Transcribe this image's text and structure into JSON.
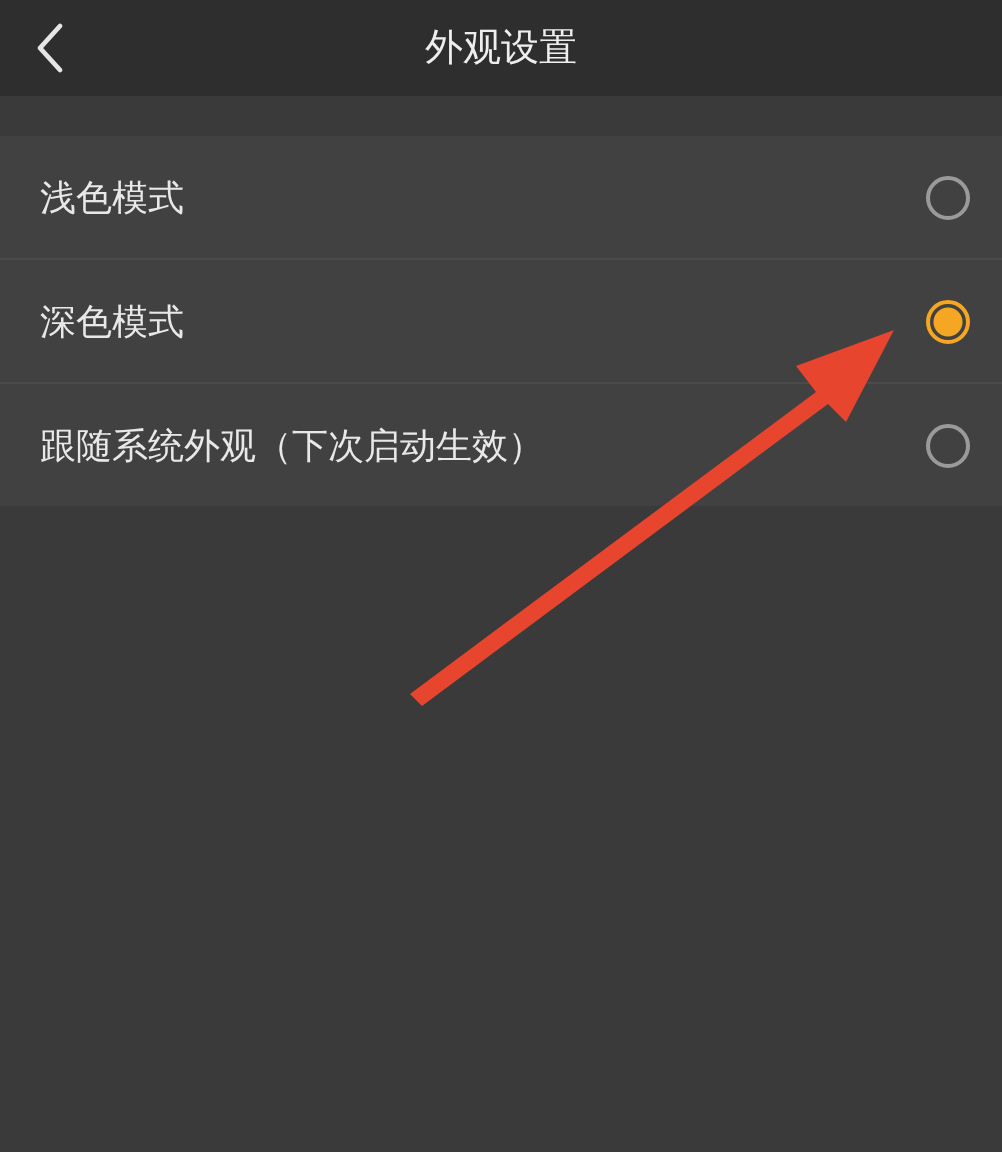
{
  "header": {
    "title": "外观设置"
  },
  "options": [
    {
      "label": "浅色模式",
      "selected": false
    },
    {
      "label": "深色模式",
      "selected": true
    },
    {
      "label": "跟随系统外观（下次启动生效）",
      "selected": false
    }
  ]
}
